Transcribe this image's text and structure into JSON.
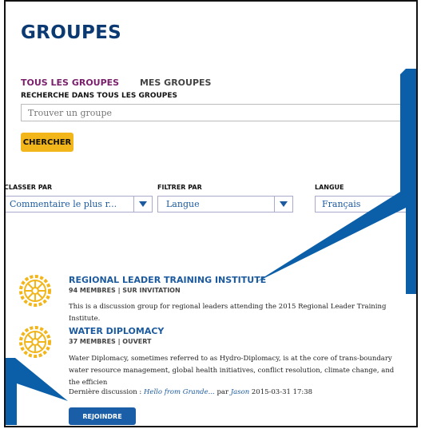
{
  "page_title": "GROUPES",
  "tabs": [
    {
      "label": "TOUS LES GROUPES",
      "active": true
    },
    {
      "label": "MES GROUPES",
      "active": false
    }
  ],
  "search": {
    "label": "RECHERCHE DANS TOUS LES GROUPES",
    "placeholder": "Trouver un groupe",
    "button": "CHERCHER"
  },
  "filters": [
    {
      "label": "CLASSER PAR",
      "value": "Commentaire le plus r..."
    },
    {
      "label": "FILTRER PAR",
      "value": "Langue"
    },
    {
      "label": "LANGUE",
      "value": "Français"
    }
  ],
  "groups": [
    {
      "title": "REGIONAL LEADER TRAINING INSTITUTE",
      "meta": "94 MEMBRES | SUR INVITATION",
      "description": "This is a discussion group for regional leaders attending the 2015 Regional Leader Training Institute."
    },
    {
      "title": "WATER DIPLOMACY",
      "meta": "37 MEMBRES | OUVERT",
      "description": "Water Diplomacy, sometimes referred to as Hydro-Diplomacy, is at the core of trans-boundary water resource management, global health initiatives, conflict resolution, climate change, and the efficien",
      "last_discussion_prefix": "Dernière discussion : ",
      "last_discussion_link": "Hello from Grande...",
      "by": " par ",
      "author": "Jason",
      "datetime": " 2015-03-31 17:38",
      "join_button": "REJOINDRE"
    }
  ],
  "colors": {
    "title_blue": "#0b3a73",
    "link_blue": "#1c5aa0",
    "active_tab": "#7a1f6b",
    "button_yellow": "#f2b51a",
    "button_blue": "#1a5ea8",
    "callout_blue": "#0a5fa8",
    "rotary_gold": "#f2b51a"
  }
}
